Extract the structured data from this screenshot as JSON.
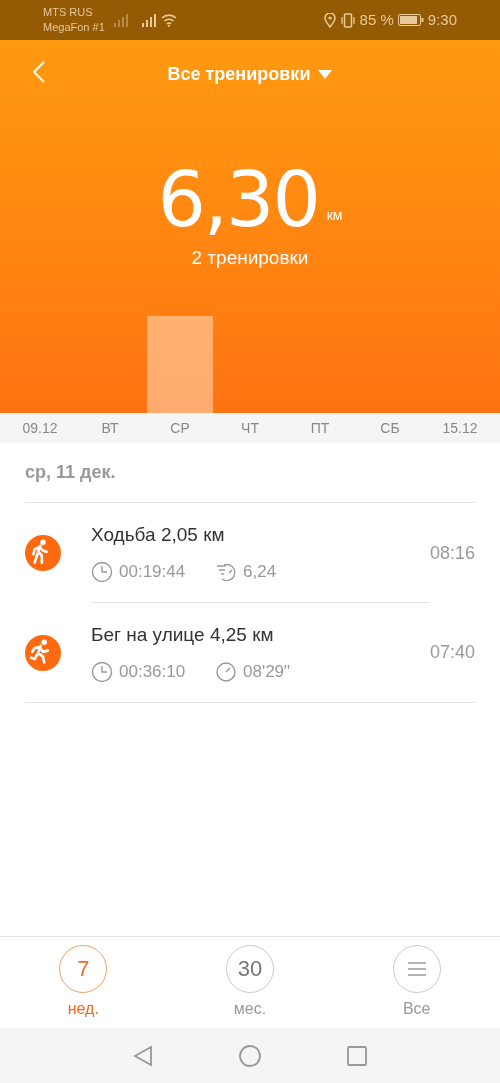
{
  "status_bar": {
    "carrier_1": "MTS RUS",
    "carrier_2": "MegaFon #1",
    "battery": "85 %",
    "time": "9:30"
  },
  "header": {
    "title": "Все тренировки",
    "total": "6,30",
    "unit": "км",
    "count": "2 тренировки"
  },
  "days": [
    {
      "label": "09.12",
      "has_bar": false
    },
    {
      "label": "ВТ",
      "has_bar": false
    },
    {
      "label": "СР",
      "has_bar": true
    },
    {
      "label": "ЧТ",
      "has_bar": false
    },
    {
      "label": "ПТ",
      "has_bar": false
    },
    {
      "label": "СБ",
      "has_bar": false
    },
    {
      "label": "15.12",
      "has_bar": false
    }
  ],
  "date": "ср, 11 дек.",
  "workouts": [
    {
      "kind": "walk",
      "title": "Ходьба 2,05 км",
      "duration": "00:19:44",
      "metric": {
        "kind": "cadence",
        "value": "6,24"
      },
      "time": "08:16"
    },
    {
      "kind": "run",
      "title": "Бег на улице 4,25 км",
      "duration": "00:36:10",
      "metric": {
        "kind": "pace",
        "value": "08'29\""
      },
      "time": "07:40"
    }
  ],
  "periods": [
    {
      "kind": "number",
      "number": "7",
      "label": "нед.",
      "selected": true
    },
    {
      "kind": "number",
      "number": "30",
      "label": "мес.",
      "selected": false
    },
    {
      "kind": "list",
      "label": "Все",
      "selected": false
    }
  ]
}
